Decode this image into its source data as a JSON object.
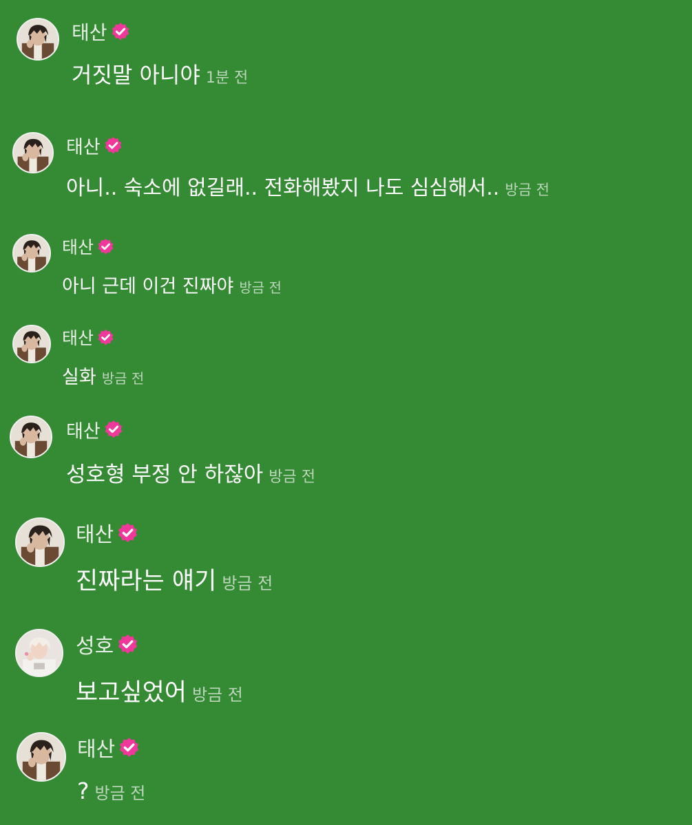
{
  "colors": {
    "background": "#358a34",
    "badge": "#f0389a",
    "name": "#e7efe6",
    "text": "#ffffff",
    "time": "#bcd6bb"
  },
  "messages": [
    {
      "sender": "태산",
      "verified": true,
      "text": "거짓말 아니야",
      "time": "1분 전",
      "avatar_icon": "taesan-avatar"
    },
    {
      "sender": "태산",
      "verified": true,
      "text": "아니.. 숙소에 없길래.. 전화해봤지 나도 심심해서..",
      "time": "방금 전",
      "avatar_icon": "taesan-avatar"
    },
    {
      "sender": "태산",
      "verified": true,
      "text": "아니 근데 이건 진짜야",
      "time": "방금 전",
      "avatar_icon": "taesan-avatar"
    },
    {
      "sender": "태산",
      "verified": true,
      "text": "실화",
      "time": "방금 전",
      "avatar_icon": "taesan-avatar"
    },
    {
      "sender": "태산",
      "verified": true,
      "text": "성호형 부정 안 하잖아",
      "time": "방금 전",
      "avatar_icon": "taesan-avatar"
    },
    {
      "sender": "태산",
      "verified": true,
      "text": "진짜라는 얘기",
      "time": "방금 전",
      "avatar_icon": "taesan-avatar"
    },
    {
      "sender": "성호",
      "verified": true,
      "text": "보고싶었어",
      "time": "방금 전",
      "avatar_icon": "sungho-avatar"
    },
    {
      "sender": "태산",
      "verified": true,
      "text": "?",
      "time": "방금 전",
      "avatar_icon": "taesan-avatar"
    }
  ]
}
